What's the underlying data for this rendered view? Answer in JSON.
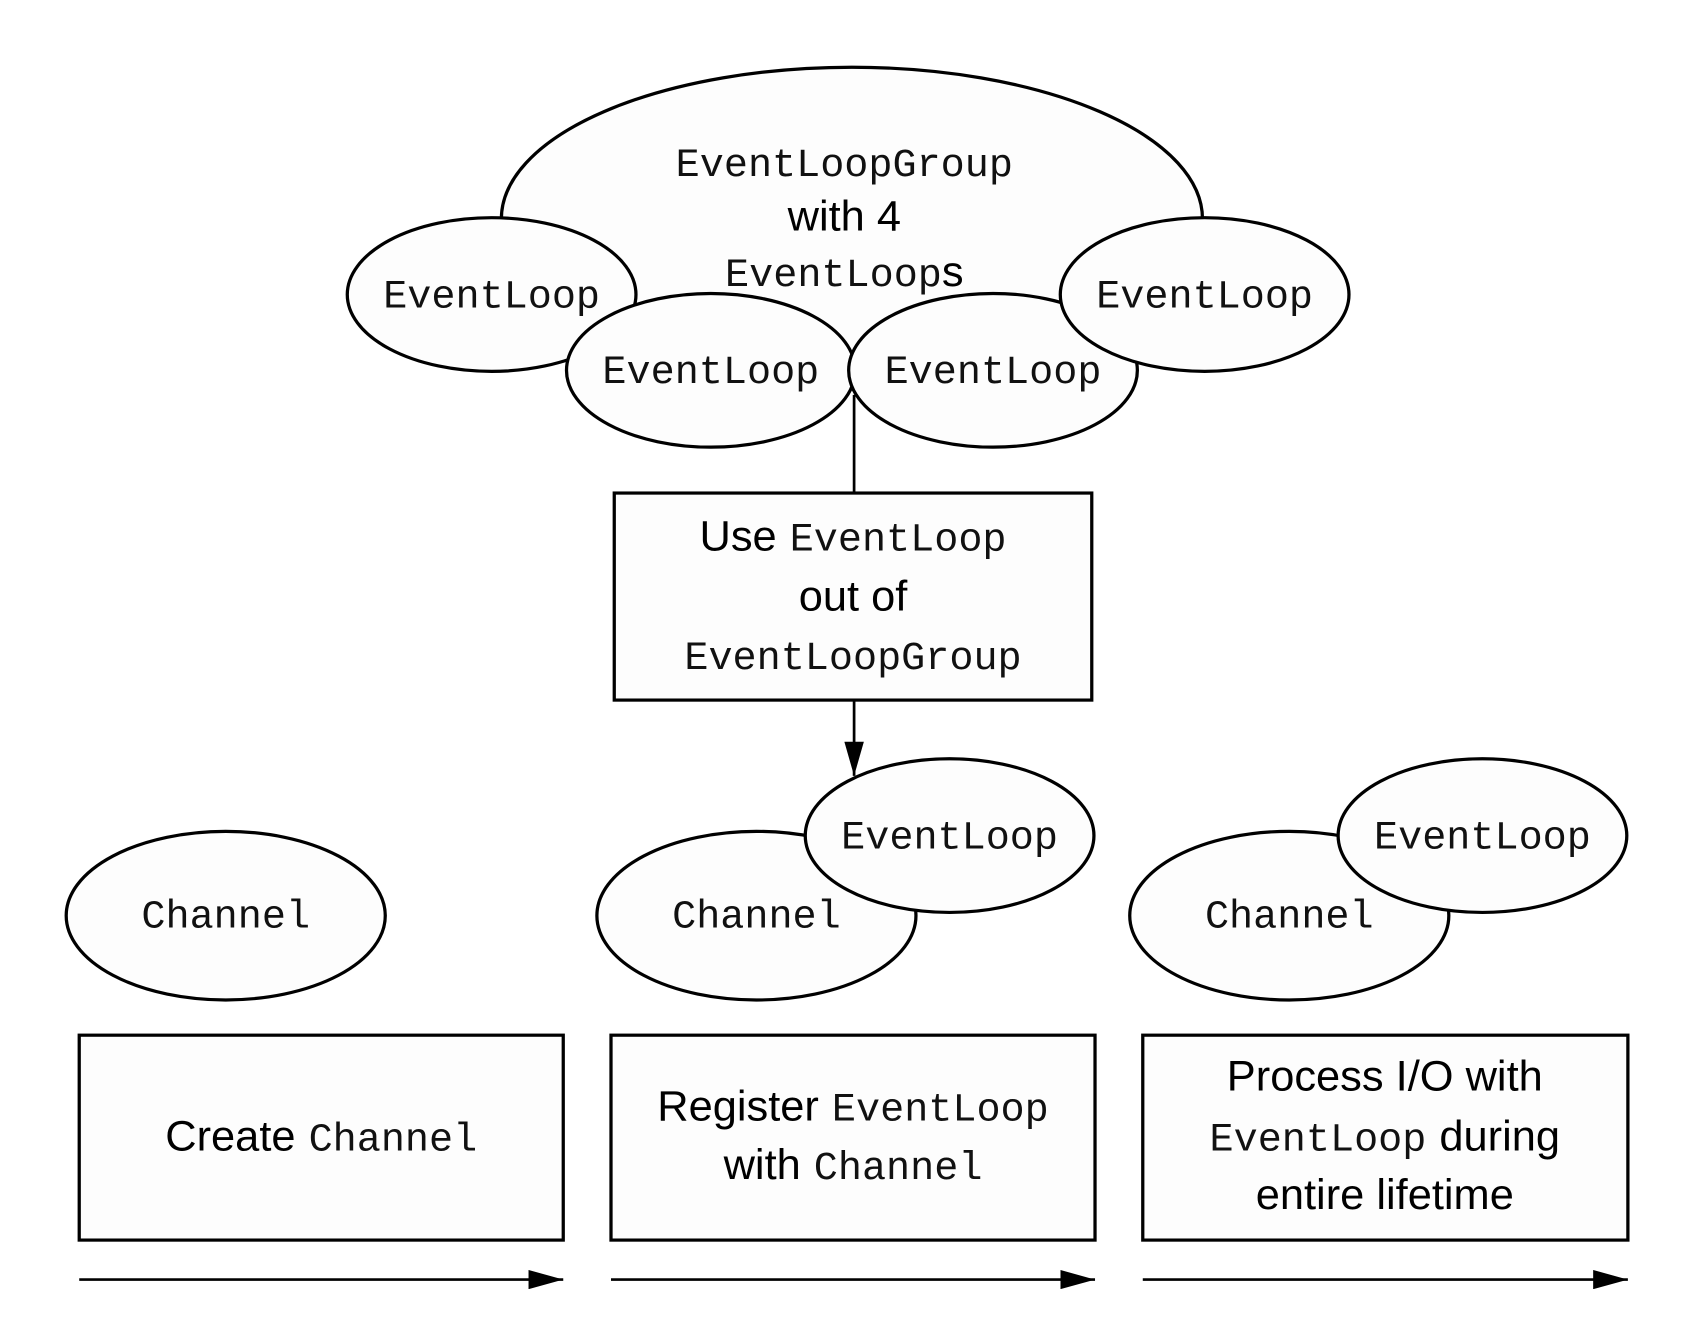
{
  "group": {
    "title_code": "EventLoopGroup",
    "title_text": "with 4",
    "title_code2": "EventLoop",
    "title_suffix": "s",
    "loops": [
      "EventLoop",
      "EventLoop",
      "EventLoop",
      "EventLoop"
    ]
  },
  "use_box": {
    "line1_text": "Use",
    "line1_code": "EventLoop",
    "line2_text": "out of",
    "line3_code": "EventLoopGroup"
  },
  "stages": [
    {
      "channel": "Channel",
      "box": {
        "text": "Create",
        "code": "Channel"
      }
    },
    {
      "channel": "Channel",
      "eventloop": "EventLoop",
      "box": {
        "text1": "Register",
        "code1": "EventLoop",
        "text2": "with",
        "code2": "Channel"
      }
    },
    {
      "channel": "Channel",
      "eventloop": "EventLoop",
      "box": {
        "line1": "Process I/O with",
        "code": "EventLoop",
        "text2": "during",
        "line3": "entire lifetime"
      }
    }
  ]
}
